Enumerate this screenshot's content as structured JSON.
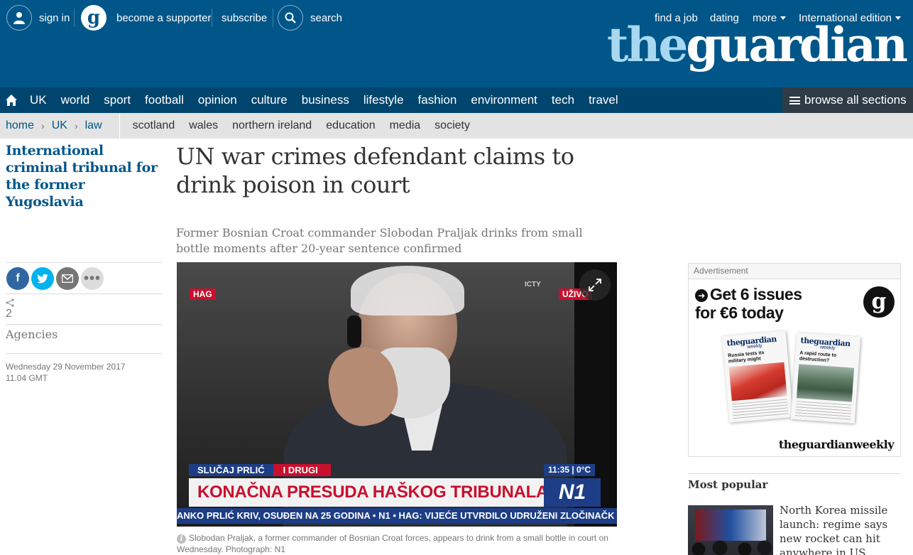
{
  "topbar": {
    "sign_in": "sign in",
    "become_supporter": "become a supporter",
    "subscribe": "subscribe",
    "search": "search",
    "find_a_job": "find a job",
    "dating": "dating",
    "more": "more",
    "edition": "International edition"
  },
  "logo": {
    "the": "the",
    "guardian": "guardian"
  },
  "pillars": {
    "items": [
      "UK",
      "world",
      "sport",
      "football",
      "opinion",
      "culture",
      "business",
      "lifestyle",
      "fashion",
      "environment",
      "tech",
      "travel"
    ],
    "browse": "browse all sections"
  },
  "subnav": {
    "breadcrumbs": [
      "home",
      "UK",
      "law"
    ],
    "links": [
      "scotland",
      "wales",
      "northern ireland",
      "education",
      "media",
      "society"
    ]
  },
  "article": {
    "series": "International criminal tribunal for the former Yugoslavia",
    "headline": "UN war crimes defendant claims to drink poison in court",
    "standfirst": "Former Bosnian Croat commander Slobodan Praljak drinks from small bottle moments after 20-year sentence confirmed",
    "share_count": "2",
    "byline": "Agencies",
    "date_line1": "Wednesday 29 November 2017",
    "date_line2": "11.04 GMT",
    "caption": "Slobodan Praljak, a former commander of Bosnian Croat forces, appears to drink from a small bottle in court on Wednesday. Photograph: N1"
  },
  "video_overlay": {
    "tag_left": "HAG",
    "tag_right": "UŽIVO",
    "icty": "ICTY",
    "case_label": "SLUČAJ PRLIĆ",
    "case_label2": "I DRUGI",
    "time": "11:35 | 0°C",
    "main_title": "KONAČNA PRESUDA HAŠKOG TRIBUNALA",
    "brand": "N1",
    "ticker": "ANKO PRLIĆ KRIV, OSUĐEN NA 25 GODINA • N1 • HAG: VIJEĆE UTVRDILO UDRUŽENI ZLOČINAČK"
  },
  "ad": {
    "label": "Advertisement",
    "headline_line1": "Get 6 issues",
    "headline_line2": "for €6 today",
    "roundel": "g",
    "paper1_logo": "theguardian",
    "paper1_weekly": "weekly",
    "paper1_head": "Russia tests its military might",
    "paper2_logo": "theguardian",
    "paper2_weekly": "weekly",
    "paper2_head": "A rapid route to destruction?",
    "footer": "theguardianweekly"
  },
  "most_popular": {
    "heading": "Most popular",
    "item1_title": "North Korea missile launch: regime says new rocket can hit anywhere in US"
  },
  "colors": {
    "brand_blue": "#005689",
    "nav_blue": "#00456e",
    "browse_bg": "#2f3b45",
    "subnav_bg": "#e3e3e3",
    "facebook": "#3067a3",
    "twitter": "#03b3ee",
    "email": "#767676",
    "more": "#dcdcdc"
  }
}
